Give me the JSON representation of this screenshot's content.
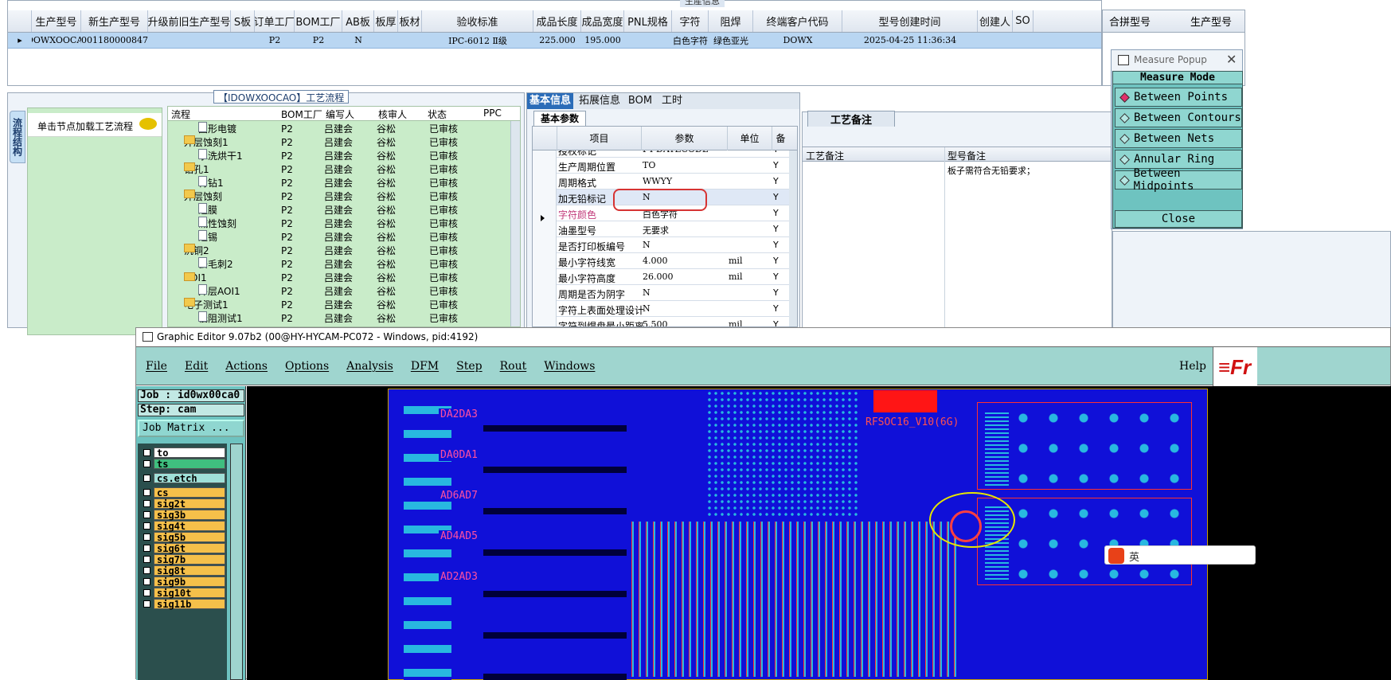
{
  "top_grid": {
    "caption": "生産信息",
    "columns": [
      "生产型号",
      "新生产型号",
      "升级前旧生产型号",
      "S板",
      "订单工厂",
      "BOM工厂",
      "AB板",
      "板厚",
      "板材",
      "验收标准",
      "成品长度",
      "成品宽度",
      "PNL规格",
      "字符",
      "阻焊",
      "终端客户代码",
      "型号创建时间",
      "创建人",
      "SO"
    ],
    "row": [
      "IDOWXOOCAO",
      "10011800008473",
      "",
      "",
      "P2",
      "P2",
      "N",
      "",
      "",
      "IPC-6012 Ⅱ级",
      "225.000",
      "195.000",
      "",
      "白色字符",
      "绿色亚光",
      "DOWX",
      "2025-04-25 11:36:34",
      "",
      ""
    ],
    "right_columns": [
      "合拼型号",
      "生产型号"
    ]
  },
  "flow": {
    "title": "【IDOWXOOCAO】工艺流程",
    "vtab": "流程结构",
    "hint": "单击节点加载工艺流程",
    "columns": [
      "流程",
      "BOM工厂",
      "编写人",
      "核审人",
      "状态",
      "PPC"
    ],
    "rows": [
      {
        "name": "图形电镀",
        "kind": "doc",
        "level": 2,
        "bom": "P2",
        "writer": "吕建会",
        "checker": "谷松",
        "status": "已审核"
      },
      {
        "name": "外层蚀刻1",
        "kind": "folder",
        "level": 1,
        "bom": "P2",
        "writer": "吕建会",
        "checker": "谷松",
        "status": "已审核"
      },
      {
        "name": "水洗烘干1",
        "kind": "doc",
        "level": 2,
        "bom": "P2",
        "writer": "吕建会",
        "checker": "谷松",
        "status": "已审核"
      },
      {
        "name": "钻孔1",
        "kind": "folder",
        "level": 1,
        "bom": "P2",
        "writer": "吕建会",
        "checker": "谷松",
        "status": "已审核"
      },
      {
        "name": "背钻1",
        "kind": "doc",
        "level": 2,
        "bom": "P2",
        "writer": "吕建会",
        "checker": "谷松",
        "status": "已审核"
      },
      {
        "name": "外层蚀刻",
        "kind": "folder",
        "level": 1,
        "bom": "P2",
        "writer": "吕建会",
        "checker": "谷松",
        "status": "已审核"
      },
      {
        "name": "退膜",
        "kind": "doc",
        "level": 2,
        "bom": "P2",
        "writer": "吕建会",
        "checker": "谷松",
        "status": "已审核"
      },
      {
        "name": "碱性蚀刻",
        "kind": "doc",
        "level": 2,
        "bom": "P2",
        "writer": "吕建会",
        "checker": "谷松",
        "status": "已审核"
      },
      {
        "name": "退锡",
        "kind": "doc",
        "level": 2,
        "bom": "P2",
        "writer": "吕建会",
        "checker": "谷松",
        "status": "已审核"
      },
      {
        "name": "沉铜2",
        "kind": "folder",
        "level": 1,
        "bom": "P2",
        "writer": "吕建会",
        "checker": "谷松",
        "status": "已审核"
      },
      {
        "name": "去毛刺2",
        "kind": "doc",
        "level": 2,
        "bom": "P2",
        "writer": "吕建会",
        "checker": "谷松",
        "status": "已审核"
      },
      {
        "name": "AOI1",
        "kind": "folder",
        "level": 1,
        "bom": "P2",
        "writer": "吕建会",
        "checker": "谷松",
        "status": "已审核"
      },
      {
        "name": "外层AOI1",
        "kind": "doc",
        "level": 2,
        "bom": "P2",
        "writer": "吕建会",
        "checker": "谷松",
        "status": "已审核"
      },
      {
        "name": "电子测试1",
        "kind": "folder",
        "level": 1,
        "bom": "P2",
        "writer": "吕建会",
        "checker": "谷松",
        "status": "已审核"
      },
      {
        "name": "低阻测试1",
        "kind": "doc",
        "level": 2,
        "bom": "P2",
        "writer": "吕建会",
        "checker": "谷松",
        "status": "已审核"
      }
    ]
  },
  "info_tabs": [
    "基本信息",
    "拓展信息",
    "BOM",
    "工时"
  ],
  "basic_params": {
    "subtab": "基本参数",
    "columns": [
      "项目",
      "参数",
      "单位",
      "备"
    ],
    "rows": [
      {
        "item": "授权标记",
        "value": "PT-DATECODE",
        "unit": "",
        "flag": "Y"
      },
      {
        "item": "生产周期位置",
        "value": "TO",
        "unit": "",
        "flag": "Y"
      },
      {
        "item": "周期格式",
        "value": "WWYY",
        "unit": "",
        "flag": "Y"
      },
      {
        "item": "加无铅标记",
        "value": "N",
        "unit": "",
        "flag": "Y",
        "selected": true
      },
      {
        "item": "字符颜色",
        "value": "白色字符",
        "unit": "",
        "flag": "Y",
        "pink": true
      },
      {
        "item": "油墨型号",
        "value": "无要求",
        "unit": "",
        "flag": "Y"
      },
      {
        "item": "是否打印板编号",
        "value": "N",
        "unit": "",
        "flag": "Y"
      },
      {
        "item": "最小字符线宽",
        "value": "4.000",
        "unit": "mil",
        "flag": "Y"
      },
      {
        "item": "最小字符高度",
        "value": "26.000",
        "unit": "mil",
        "flag": "Y"
      },
      {
        "item": "周期是否为阴字",
        "value": "N",
        "unit": "",
        "flag": "Y"
      },
      {
        "item": "字符上表面处理设计",
        "value": "N",
        "unit": "",
        "flag": "Y"
      },
      {
        "item": "字符到焊盘最小距离",
        "value": "5.500",
        "unit": "mil",
        "flag": "Y"
      }
    ]
  },
  "notes": {
    "tab": "工艺备注",
    "col1": "工艺备注",
    "col2": "型号备注",
    "model_note": "板子需符合无铅要求；"
  },
  "measure": {
    "title": "Measure Popup",
    "mode_label": "Measure Mode",
    "items": [
      "Between Points",
      "Between Contours",
      "Between Nets",
      "Annular Ring",
      "Between Midpoints"
    ],
    "selected": 0,
    "close": "Close"
  },
  "editor": {
    "title": "Graphic Editor 9.07b2 (00@HY-HYCAM-PC072 - Windows, pid:4192)",
    "menu": [
      "File",
      "Edit",
      "Actions",
      "Options",
      "Analysis",
      "DFM",
      "Step",
      "Rout",
      "Windows"
    ],
    "help": "Help",
    "job": "Job : id0wx00ca0",
    "step": "Step: cam",
    "job_matrix": "Job Matrix ...",
    "layers": [
      {
        "name": "to",
        "color": "#ffffff"
      },
      {
        "name": "ts",
        "color": "#3fbf7f"
      },
      {
        "name": "cs.etch",
        "color": "#9fe0d8"
      },
      {
        "name": "cs",
        "color": "#f5c04a"
      },
      {
        "name": "sig2t",
        "color": "#f5c04a"
      },
      {
        "name": "sig3b",
        "color": "#f5c04a"
      },
      {
        "name": "sig4t",
        "color": "#f5c04a"
      },
      {
        "name": "sig5b",
        "color": "#f5c04a"
      },
      {
        "name": "sig6t",
        "color": "#f5c04a"
      },
      {
        "name": "sig7b",
        "color": "#f5c04a"
      },
      {
        "name": "sig8t",
        "color": "#f5c04a"
      },
      {
        "name": "sig9b",
        "color": "#f5c04a"
      },
      {
        "name": "sig10t",
        "color": "#f5c04a"
      },
      {
        "name": "sig11b",
        "color": "#f5c04a"
      }
    ],
    "pcb_labels": [
      "DA2DA3",
      "DA0DA1",
      "AD6AD7",
      "AD4AD5",
      "AD2AD3"
    ],
    "pcb_text": "RFSOC16_V10(6G)",
    "ime_text": "英"
  }
}
